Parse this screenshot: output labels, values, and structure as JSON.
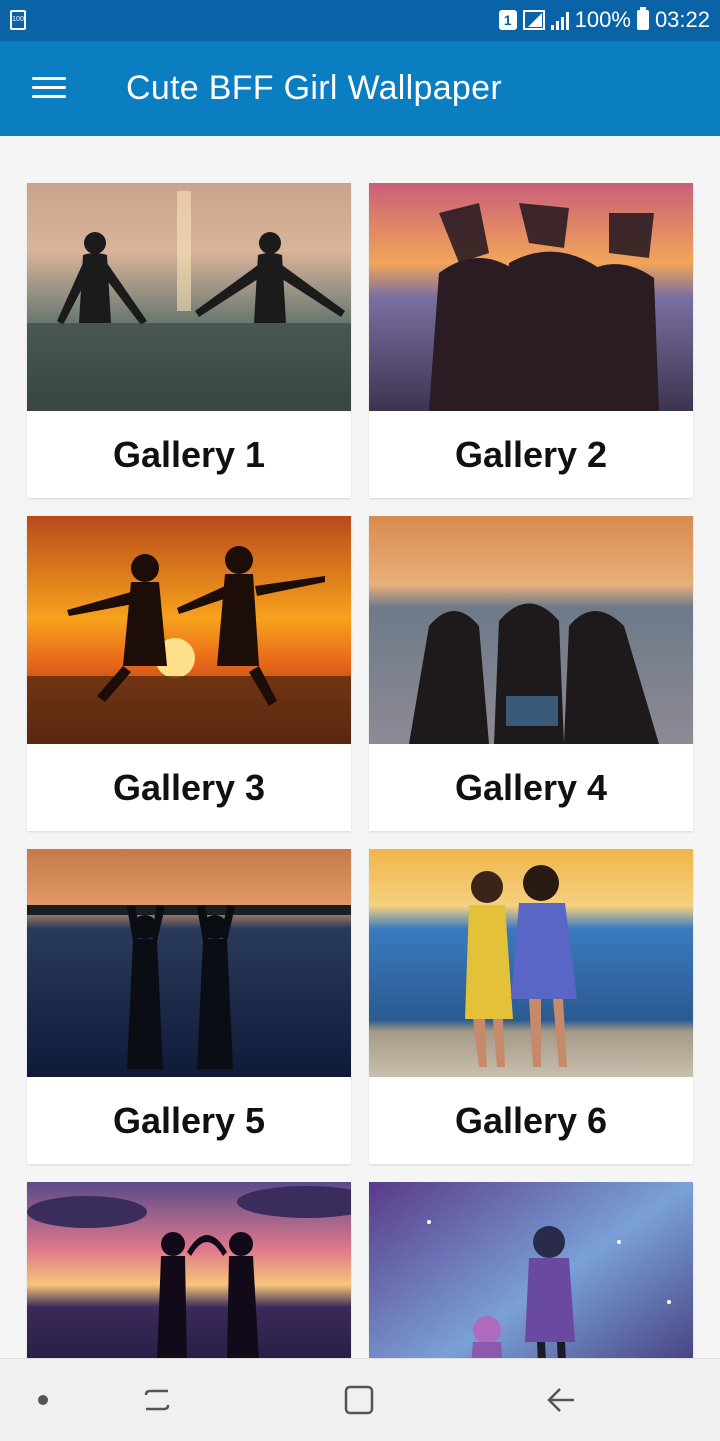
{
  "status_bar": {
    "left_icon_text": "100",
    "sim_slot": "1",
    "battery_percent": "100%",
    "time": "03:22"
  },
  "app_bar": {
    "title": "Cute BFF Girl Wallpaper",
    "menu_icon": "hamburger-menu-icon"
  },
  "galleries": [
    {
      "label": "Gallery 1"
    },
    {
      "label": "Gallery 2"
    },
    {
      "label": "Gallery 3"
    },
    {
      "label": "Gallery 4"
    },
    {
      "label": "Gallery 5"
    },
    {
      "label": "Gallery 6"
    },
    {
      "label": ""
    },
    {
      "label": ""
    }
  ],
  "nav_bar": {
    "icons": [
      "dot-icon",
      "recent-apps-icon",
      "home-icon",
      "back-icon"
    ]
  },
  "colors": {
    "status_bar": "#0a63a6",
    "app_bar": "#0b7dc1",
    "background": "#f5f5f5"
  }
}
